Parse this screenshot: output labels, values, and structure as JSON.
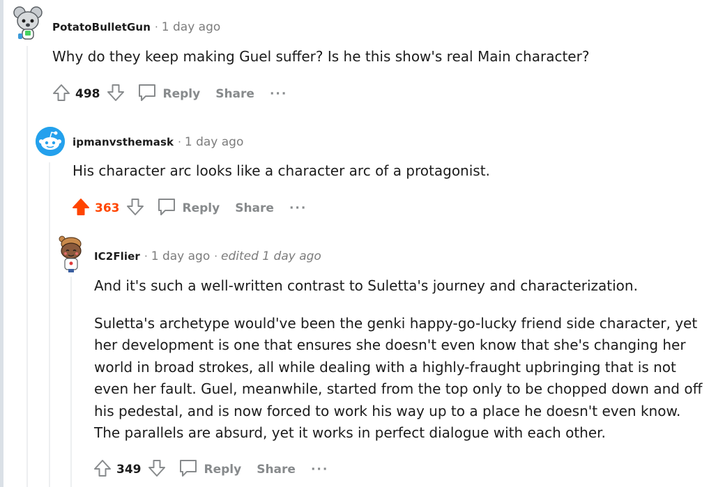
{
  "comments": [
    {
      "author": "PotatoBulletGun",
      "separator": "·",
      "time": "1 day ago",
      "body": [
        "Why do they keep making Guel suffer? Is he this show's real Main character?"
      ],
      "score": "498",
      "reply_label": "Reply",
      "share_label": "Share",
      "more_label": "···",
      "upvoted": false,
      "avatar_icon": "snoo-koala-avatar-icon"
    },
    {
      "author": "ipmanvsthemask",
      "separator": "·",
      "time": "1 day ago",
      "body": [
        "His character arc looks like a character arc of a protagonist."
      ],
      "score": "363",
      "reply_label": "Reply",
      "share_label": "Share",
      "more_label": "···",
      "upvoted": true,
      "avatar_icon": "snoo-default-avatar-icon"
    },
    {
      "author": "IC2Flier",
      "separator": "·",
      "time": "1 day ago",
      "separator2": "·",
      "edited": "edited 1 day ago",
      "body": [
        "And it's such a well-written contrast to Suletta's journey and characterization.",
        "Suletta's archetype would've been the genki happy-go-lucky friend side character, yet",
        "her development is one that ensures she doesn't even know that she's changing her",
        "world in broad strokes, all while dealing with a highly-fraught upbringing that is not",
        "even her fault. Guel, meanwhile, started from the top only to be chopped down and off",
        "his pedestal, and is now forced to work his way up to a place he doesn't even know.",
        "The parallels are absurd, yet it works in perfect dialogue with each other."
      ],
      "score": "349",
      "reply_label": "Reply",
      "share_label": "Share",
      "more_label": "···",
      "upvoted": false,
      "avatar_icon": "snoo-beanie-avatar-icon"
    }
  ],
  "colors": {
    "upvote_active": "#ff4500",
    "muted": "#878a8c",
    "thread_line": "#edeff1"
  }
}
